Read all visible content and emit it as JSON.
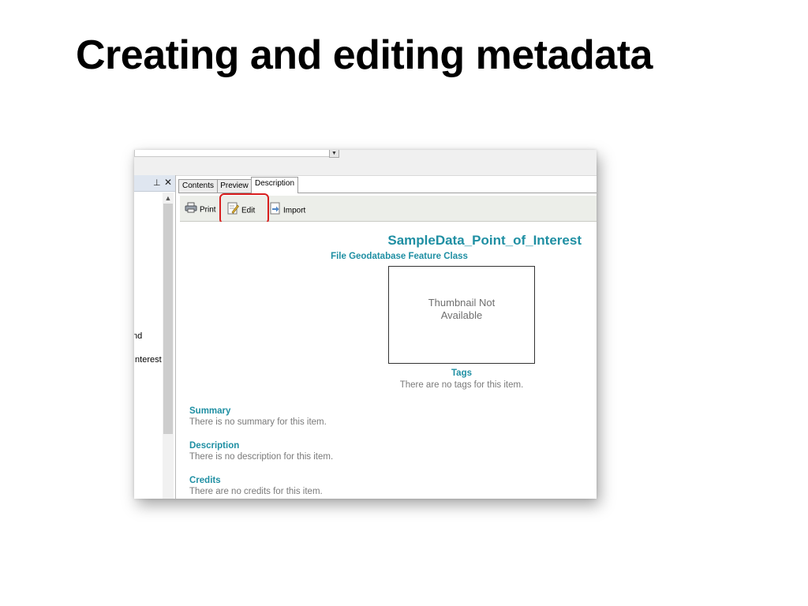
{
  "slide": {
    "title": "Creating and editing metadata"
  },
  "left_pane": {
    "items": [
      "nd",
      "Interest"
    ]
  },
  "tabs": [
    {
      "label": "Contents",
      "active": false
    },
    {
      "label": "Preview",
      "active": false
    },
    {
      "label": "Description",
      "active": true
    }
  ],
  "toolbar": {
    "print_label": "Print",
    "edit_label": "Edit",
    "import_label": "Import",
    "highlight_color": "#d81e1e"
  },
  "description": {
    "title": "SampleData_Point_of_Interest",
    "item_type": "File Geodatabase Feature Class",
    "thumbnail_line1": "Thumbnail Not",
    "thumbnail_line2": "Available",
    "tags_label": "Tags",
    "tags_text": "There are no tags for this item.",
    "summary_label": "Summary",
    "summary_text": "There is no summary for this item.",
    "description_label": "Description",
    "description_text": "There is no description for this item.",
    "credits_label": "Credits",
    "credits_text": "There are no credits for this item.",
    "accent_color": "#1f8fa3"
  }
}
